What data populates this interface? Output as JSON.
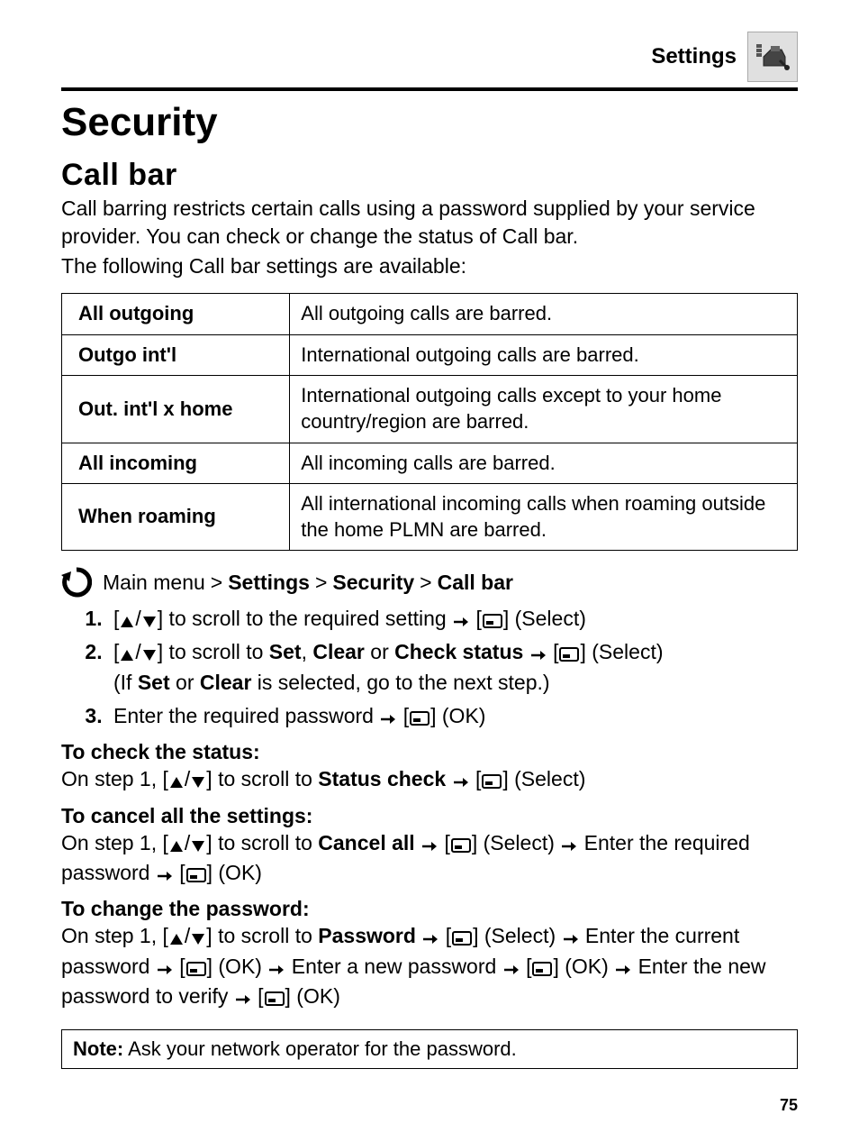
{
  "header": {
    "section_label": "Settings"
  },
  "title": "Security",
  "subsection": "Call bar",
  "intro1": "Call barring restricts certain calls using a password supplied by your service provider. You can check or change the status of Call bar.",
  "intro2": "The following Call bar settings are available:",
  "table": [
    {
      "key": "All outgoing",
      "val": "All outgoing calls are barred."
    },
    {
      "key": "Outgo int'l",
      "val": "International outgoing calls are barred."
    },
    {
      "key": "Out. int'l x home",
      "val": "International outgoing calls except to your home country/region are barred."
    },
    {
      "key": "All incoming",
      "val": "All incoming calls are barred."
    },
    {
      "key": "When roaming",
      "val": "All international incoming calls when roaming outside the home PLMN are barred."
    }
  ],
  "breadcrumb": {
    "prefix": "Main menu",
    "p1": "Settings",
    "p2": "Security",
    "p3": "Call bar"
  },
  "steps": {
    "s1a": "] to scroll to the required setting ",
    "s1b": "] (Select)",
    "s2a": "] to scroll to ",
    "s2b": "Set",
    "s2c": ", ",
    "s2d": "Clear",
    "s2e": " or ",
    "s2f": "Check status",
    "s2g": "] (Select)",
    "s2h": "(If ",
    "s2i": "Set",
    "s2j": " or ",
    "s2k": "Clear",
    "s2l": " is selected, go to the next step.)",
    "s3a": "Enter the required password ",
    "s3b": "] (OK)"
  },
  "check": {
    "heading": "To check the status:",
    "t1": "On step 1, [",
    "t2": "] to scroll to ",
    "t3": "Status check",
    "t4": "] (Select)"
  },
  "cancel": {
    "heading": "To cancel all the settings:",
    "t1": "On step 1, [",
    "t2": "] to scroll to ",
    "t3": "Cancel all",
    "t4": "] (Select) ",
    "t5": " Enter the required password ",
    "t6": "] (OK)"
  },
  "password": {
    "heading": "To change the password:",
    "t1": "On step 1, [",
    "t2": "] to scroll to ",
    "t3": "Password",
    "t4": "] (Select) ",
    "t5": " Enter the current password ",
    "t6": "] (OK) ",
    "t7": " Enter a new password ",
    "t8": "] (OK) ",
    "t9": " Enter the new password to verify ",
    "t10": "] (OK)"
  },
  "note": {
    "label": "Note:",
    "text": " Ask your network operator for the password."
  },
  "page_number": "75"
}
